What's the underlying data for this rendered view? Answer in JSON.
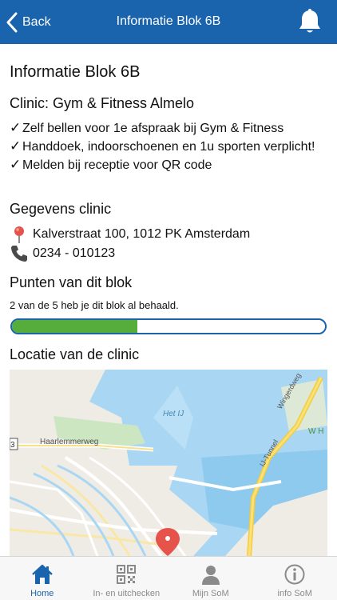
{
  "nav": {
    "back_label": "Back",
    "title": "Informatie Blok 6B"
  },
  "page": {
    "title": "Informatie Blok 6B",
    "clinic_label": "Clinic: Gym & Fitness Almelo",
    "checks": [
      "Zelf bellen voor 1e afspraak bij Gym & Fitness",
      "Handdoek, indoorschoenen en 1u sporten verplicht!",
      "Melden bij receptie voor QR code"
    ],
    "check_symbol": "✓"
  },
  "contact": {
    "heading": "Gegevens clinic",
    "address": "Kalverstraat 100, 1012 PK Amsterdam",
    "phone": "0234 - 010123"
  },
  "progress": {
    "heading": "Punten van dit blok",
    "text": "2 van de 5 heb je dit blok al behaald.",
    "achieved": 2,
    "total": 5
  },
  "map": {
    "heading": "Locatie van de clinic",
    "labels": {
      "het_ij": "Het IJ",
      "haarlemmerweg": "Haarlemmerweg",
      "ij_tunnel": "IJ-Tunnel",
      "wingerdweg": "Wingerdweg",
      "wh": "W H",
      "route": "3"
    }
  },
  "tabs": [
    {
      "label": "Home",
      "icon": "home-icon",
      "active": true
    },
    {
      "label": "In- en uitchecken",
      "icon": "qr-code-icon",
      "active": false
    },
    {
      "label": "Mijn SoM",
      "icon": "user-icon",
      "active": false
    },
    {
      "label": "info SoM",
      "icon": "info-icon",
      "active": false
    }
  ],
  "colors": {
    "primary": "#1a64ad",
    "progress": "#57ad3b",
    "pin": "#e5534b"
  }
}
